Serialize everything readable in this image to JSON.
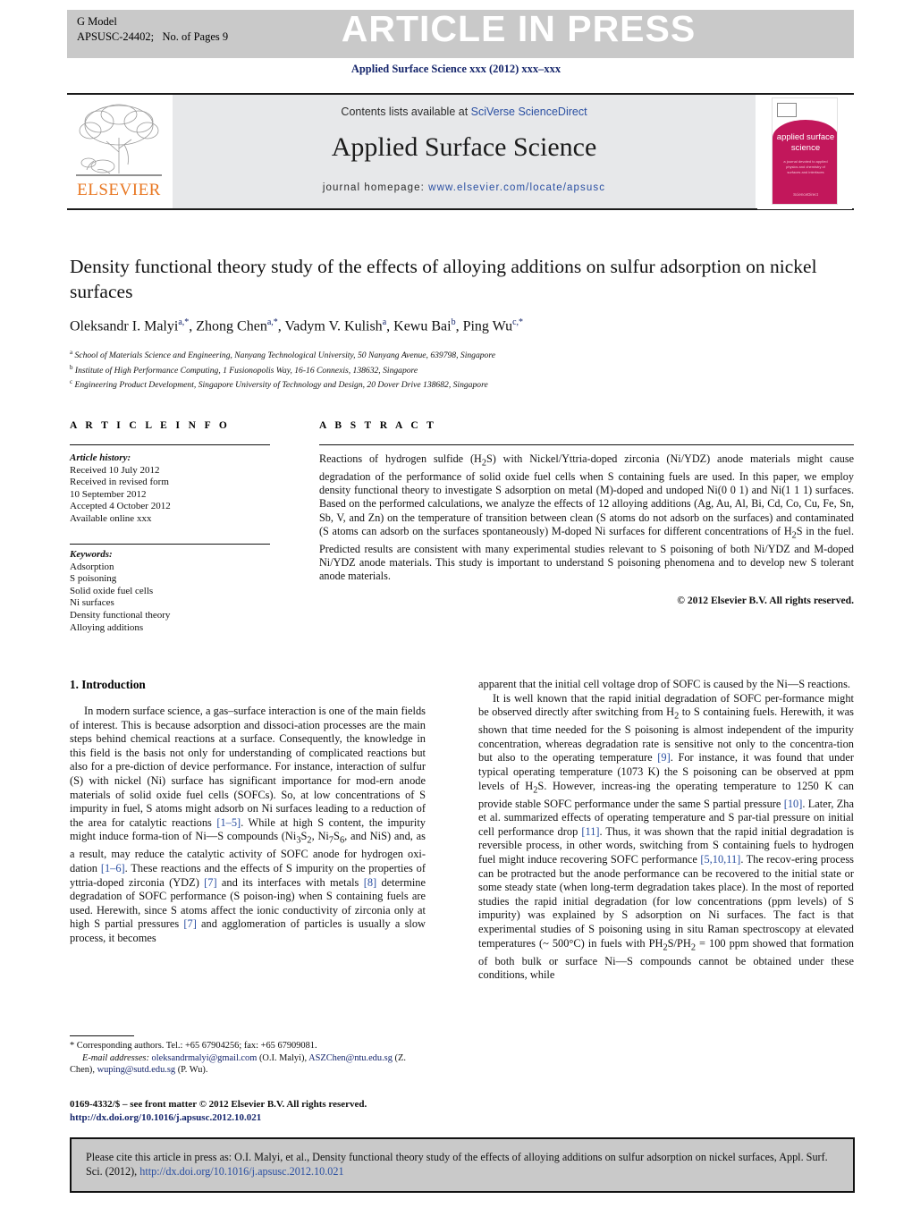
{
  "header": {
    "g_model": "G Model",
    "article_id": "APSUSC-24402;   No. of Pages 9",
    "stamp": "ARTICLE IN PRESS",
    "journal_ref": "Applied Surface Science xxx (2012) xxx–xxx"
  },
  "masthead": {
    "contents_prefix": "Contents lists available at ",
    "contents_link": "SciVerse ScienceDirect",
    "journal_name": "Applied Surface Science",
    "homepage_label": "journal homepage: ",
    "homepage_url": "www.elsevier.com/locate/apsusc",
    "publisher": "ELSEVIER",
    "cover_title": "applied surface science",
    "cover_subtitle": "a journal devoted to applied physics and chemistry of surfaces and interfaces",
    "cover_footer": "ScienceDirect"
  },
  "article": {
    "title": "Density functional theory study of the effects of alloying additions on sulfur adsorption on nickel surfaces",
    "authors_html": "Oleksandr I. Malyi<sup>a,*</sup>, Zhong Chen<sup>a,*</sup>, Vadym V. Kulish<sup>a</sup>, Kewu Bai<sup>b</sup>, Ping Wu<sup>c,*</sup>",
    "affiliations": [
      "School of Materials Science and Engineering, Nanyang Technological University, 50 Nanyang Avenue, 639798, Singapore",
      "Institute of High Performance Computing, 1 Fusionopolis Way, 16-16 Connexis, 138632, Singapore",
      "Engineering Product Development, Singapore University of Technology and Design, 20 Dover Drive 138682, Singapore"
    ],
    "affiliation_marks": [
      "a",
      "b",
      "c"
    ]
  },
  "article_info": {
    "heading": "A R T I C L E  I N F O",
    "history_label": "Article history:",
    "history": [
      "Received 10 July 2012",
      "Received in revised form",
      "10 September 2012",
      "Accepted 4 October 2012",
      "Available online xxx"
    ],
    "keywords_label": "Keywords:",
    "keywords": [
      "Adsorption",
      "S poisoning",
      "Solid oxide fuel cells",
      "Ni surfaces",
      "Density functional theory",
      "Alloying additions"
    ]
  },
  "abstract": {
    "heading": "A B S T R A C T",
    "text": "Reactions of hydrogen sulfide (H2S) with Nickel/Yttria-doped zirconia (Ni/YDZ) anode materials might cause degradation of the performance of solid oxide fuel cells when S containing fuels are used. In this paper, we employ density functional theory to investigate S adsorption on metal (M)-doped and undoped Ni(0 0 1) and Ni(1 1 1) surfaces. Based on the performed calculations, we analyze the effects of 12 alloying additions (Ag, Au, Al, Bi, Cd, Co, Cu, Fe, Sn, Sb, V, and Zn) on the temperature of transition between clean (S atoms do not adsorb on the surfaces) and contaminated (S atoms can adsorb on the surfaces spontaneously) M-doped Ni surfaces for different concentrations of H2S in the fuel. Predicted results are consistent with many experimental studies relevant to S poisoning of both Ni/YDZ and M-doped Ni/YDZ anode materials. This study is important to understand S poisoning phenomena and to develop new S tolerant anode materials.",
    "copyright": "© 2012 Elsevier B.V. All rights reserved."
  },
  "body": {
    "section_heading": "1. Introduction",
    "left_paragraph_1": "In modern surface science, a gas–surface interaction is one of the main fields of interest. This is because adsorption and dissoci-ation processes are the main steps behind chemical reactions at a surface. Consequently, the knowledge in this field is the basis not only for understanding of complicated reactions but also for a pre-diction of device performance. For instance, interaction of sulfur (S) with nickel (Ni) surface has significant importance for mod-ern anode materials of solid oxide fuel cells (SOFCs). So, at low concentrations of S impurity in fuel, S atoms might adsorb on Ni surfaces leading to a reduction of the area for catalytic reactions [1–5]. While at high S content, the impurity might induce forma-tion of Ni—S compounds (Ni3S2, Ni7S6, and NiS) and, as a result, may reduce the catalytic activity of SOFC anode for hydrogen oxi-dation [1–6]. These reactions and the effects of S impurity on the properties of yttria-doped zirconia (YDZ) [7] and its interfaces with metals [8] determine degradation of SOFC performance (S poison-ing) when S containing fuels are used. Herewith, since S atoms affect the ionic conductivity of zirconia only at high S partial pressures [7] and agglomeration of particles is usually a slow process, it becomes",
    "right_paragraph_1": "apparent that the initial cell voltage drop of SOFC is caused by the Ni—S reactions.",
    "right_paragraph_2": "It is well known that the rapid initial degradation of SOFC per-formance might be observed directly after switching from H2 to S containing fuels. Herewith, it was shown that time needed for the S poisoning is almost independent of the impurity concentration, whereas degradation rate is sensitive not only to the concentra-tion but also to the operating temperature [9]. For instance, it was found that under typical operating temperature (1073 K) the S poisoning can be observed at ppm levels of H2S. However, increas-ing the operating temperature to 1250 K can provide stable SOFC performance under the same S partial pressure [10]. Later, Zha et al. summarized effects of operating temperature and S par-tial pressure on initial cell performance drop [11]. Thus, it was shown that the rapid initial degradation is reversible process, in other words, switching from S containing fuels to hydrogen fuel might induce recovering SOFC performance [5,10,11]. The recov-ering process can be protracted but the anode performance can be recovered to the initial state or some steady state (when long-term degradation takes place). In the most of reported studies the rapid initial degradation (for low concentrations (ppm levels) of S impurity) was explained by S adsorption on Ni surfaces. The fact is that experimental studies of S poisoning using in situ Raman spectroscopy at elevated temperatures (~ 500°C) in fuels with PH2S/PH2 = 100 ppm showed that formation of both bulk or surface Ni—S compounds cannot be obtained under these conditions, while"
  },
  "footnotes": {
    "corresponding": "* Corresponding authors. Tel.: +65 67904256; fax: +65 67909081.",
    "email_label": "E-mail addresses:",
    "emails": [
      {
        "address": "oleksandrmalyi@gmail.com",
        "person": "(O.I. Malyi)"
      },
      {
        "address": "ASZChen@ntu.edu.sg",
        "person": "(Z. Chen)"
      },
      {
        "address": "wuping@sutd.edu.sg",
        "person": "(P. Wu)"
      }
    ],
    "issn_line": "0169-4332/$ – see front matter © 2012 Elsevier B.V. All rights reserved.",
    "doi_line": "http://dx.doi.org/10.1016/j.apsusc.2012.10.021"
  },
  "cite_box": {
    "text": "Please cite this article in press as: O.I. Malyi, et al., Density functional theory study of the effects of alloying additions on sulfur adsorption on nickel surfaces, Appl. Surf. Sci. (2012), ",
    "doi": "http://dx.doi.org/10.1016/j.apsusc.2012.10.021"
  },
  "colors": {
    "link_blue": "#2a4fa2",
    "navy": "#15256b",
    "elsevier_orange": "#e87722",
    "cover_magenta": "#c2175b",
    "grey_bar": "#c9c9c9",
    "masthead_grey": "#e7e8ea"
  }
}
